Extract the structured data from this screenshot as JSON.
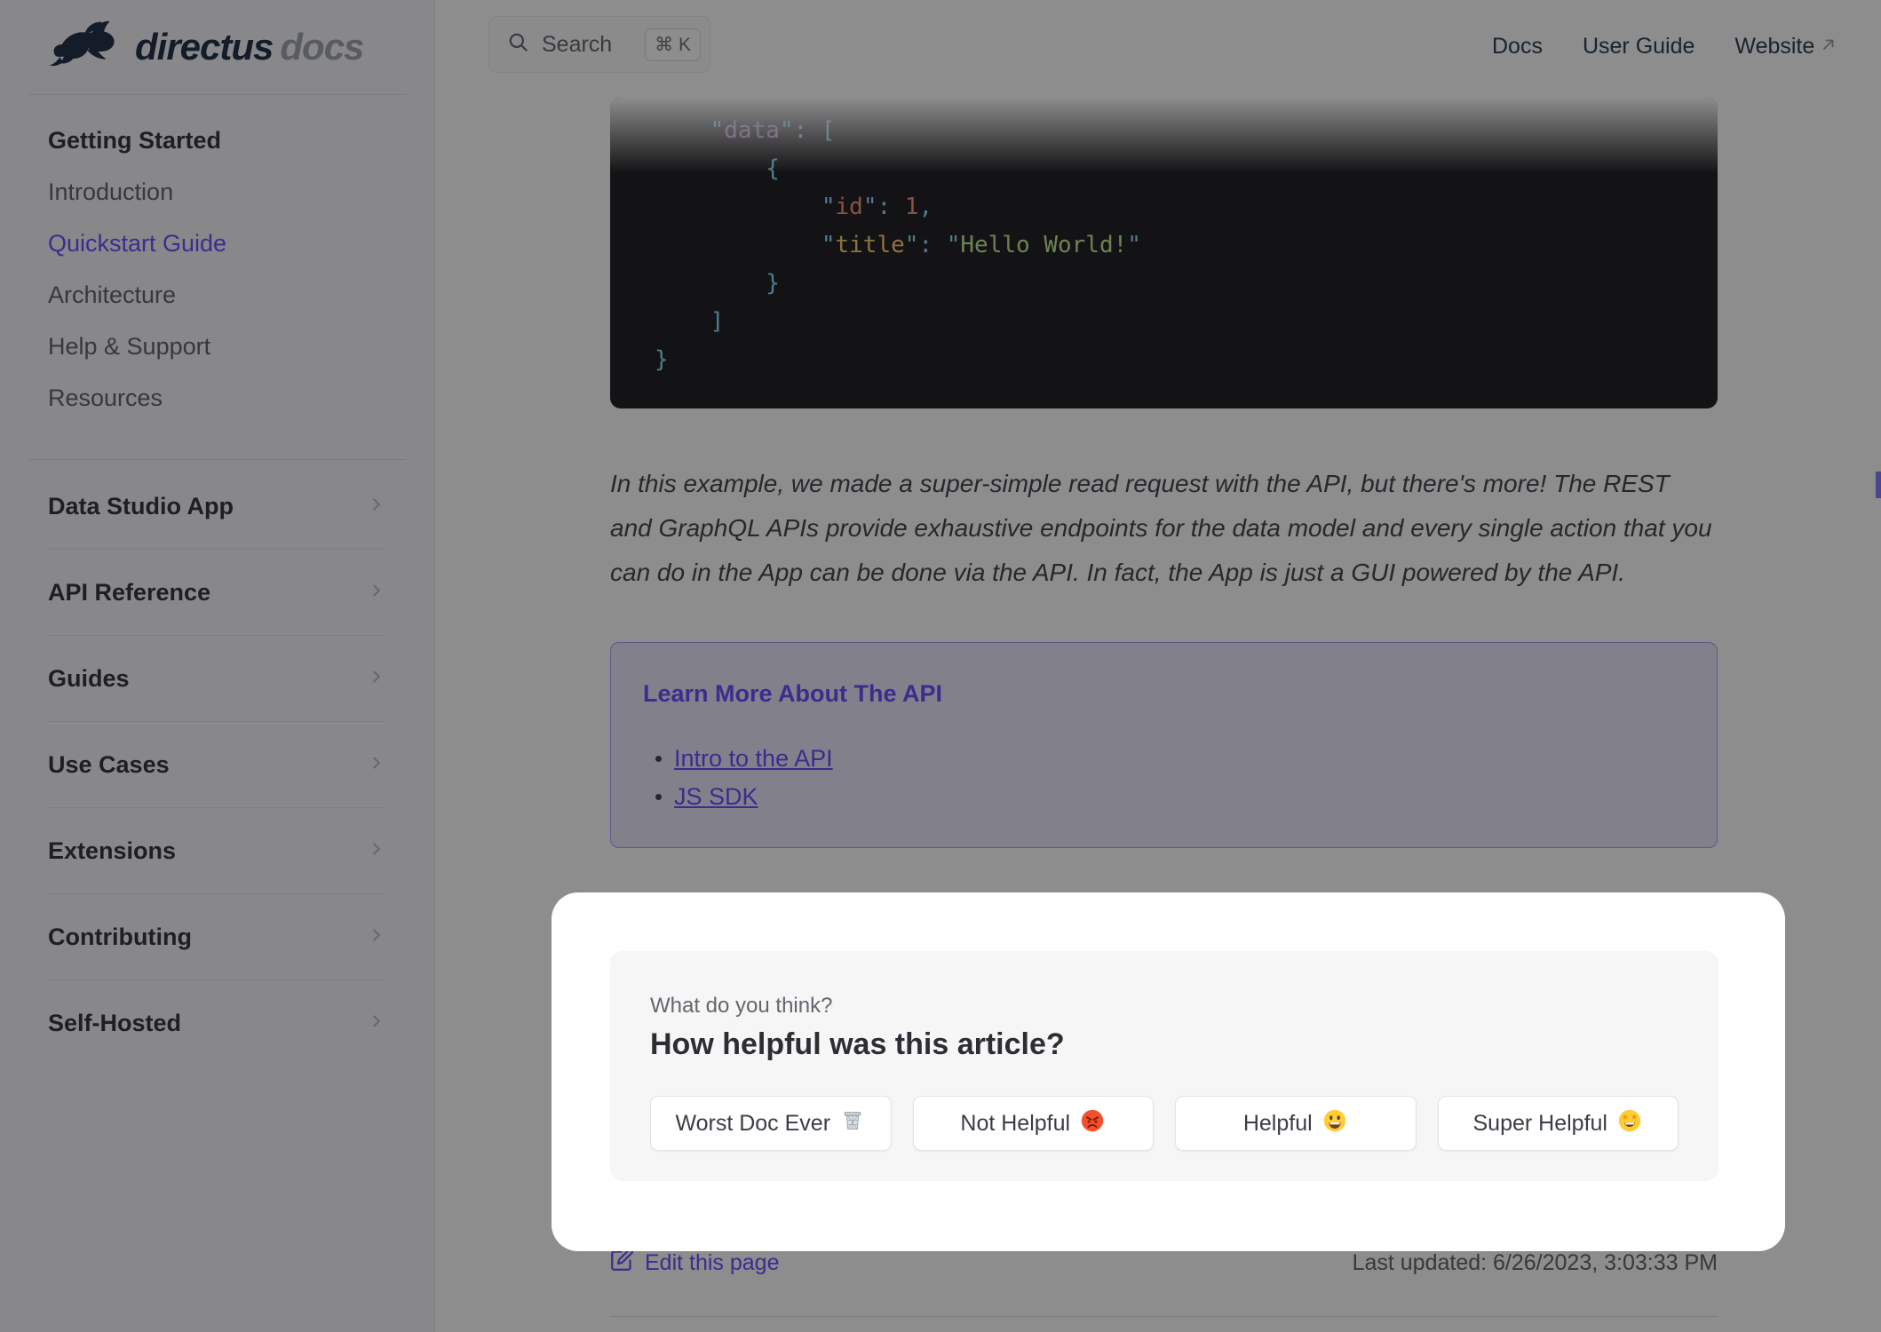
{
  "header": {
    "logo": {
      "brand": "directus",
      "suffix": "docs"
    },
    "search": {
      "label": "Search",
      "shortcut": "⌘ K"
    },
    "nav": [
      {
        "label": "Docs"
      },
      {
        "label": "User Guide"
      },
      {
        "label": "Website"
      }
    ]
  },
  "sidebar": {
    "group_title": "Getting Started",
    "links": [
      {
        "label": "Introduction"
      },
      {
        "label": "Quickstart Guide",
        "active": true
      },
      {
        "label": "Architecture"
      },
      {
        "label": "Help & Support"
      },
      {
        "label": "Resources"
      }
    ],
    "sections": [
      {
        "label": "Data Studio App"
      },
      {
        "label": "API Reference"
      },
      {
        "label": "Guides"
      },
      {
        "label": "Use Cases"
      },
      {
        "label": "Extensions"
      },
      {
        "label": "Contributing"
      },
      {
        "label": "Self-Hosted"
      }
    ]
  },
  "content": {
    "code": {
      "token_colors": {
        "pln": "#a6accd",
        "q": "#89ddff",
        "p": "#89ddff",
        "b": "#89ddff",
        "k1": "#c792ea",
        "k2": "#f78c6c",
        "k3": "#ffcb6b",
        "n": "#f78c6c",
        "s": "#c3e88d"
      },
      "lines": [
        [
          [
            "pln",
            "    "
          ],
          [
            "q",
            "\""
          ],
          [
            "k1",
            "data"
          ],
          [
            "q",
            "\""
          ],
          [
            "p",
            ": "
          ],
          [
            "b",
            "["
          ]
        ],
        [
          [
            "pln",
            "        "
          ],
          [
            "b",
            "{"
          ]
        ],
        [
          [
            "pln",
            "            "
          ],
          [
            "q",
            "\""
          ],
          [
            "k2",
            "id"
          ],
          [
            "q",
            "\""
          ],
          [
            "p",
            ": "
          ],
          [
            "n",
            "1"
          ],
          [
            "p",
            ","
          ]
        ],
        [
          [
            "pln",
            "            "
          ],
          [
            "q",
            "\""
          ],
          [
            "k3",
            "title"
          ],
          [
            "q",
            "\""
          ],
          [
            "p",
            ": "
          ],
          [
            "q",
            "\""
          ],
          [
            "s",
            "Hello World!"
          ],
          [
            "q",
            "\""
          ]
        ],
        [
          [
            "pln",
            "        "
          ],
          [
            "b",
            "}"
          ]
        ],
        [
          [
            "pln",
            "    "
          ],
          [
            "b",
            "]"
          ]
        ],
        [
          [
            "b",
            "}"
          ]
        ]
      ]
    },
    "paragraph": "In this example, we made a super-simple read request with the API, but there's more! The REST and GraphQL APIs provide exhaustive endpoints for the data model and every single action that you can do in the App can be done via the API. In fact, the App is just a GUI powered by the API.",
    "callout": {
      "title": "Learn More About The API",
      "links": [
        "Intro to the API",
        "JS SDK"
      ]
    },
    "footer": {
      "edit_label": "Edit this page",
      "last_updated": "Last updated: 6/26/2023, 3:03:33 PM"
    }
  },
  "feedback": {
    "kicker": "What do you think?",
    "title": "How helpful was this article?",
    "buttons": [
      {
        "label": "Worst Doc Ever",
        "emoji": "wastebasket"
      },
      {
        "label": "Not Helpful",
        "emoji": "enraged-face"
      },
      {
        "label": "Helpful",
        "emoji": "grinning-face"
      },
      {
        "label": "Super Helpful",
        "emoji": "star-struck"
      }
    ]
  },
  "colors": {
    "accent": "#6644ff",
    "code_background": "#161618",
    "callout_background": "#eae9f9"
  }
}
